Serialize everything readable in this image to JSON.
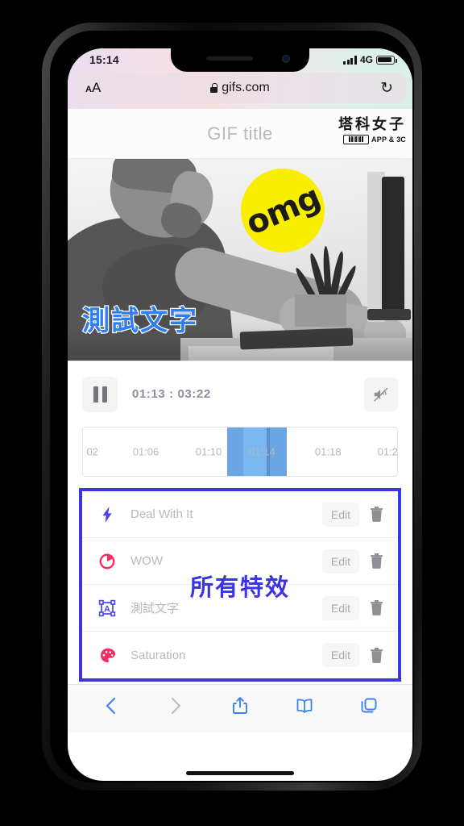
{
  "status_bar": {
    "time": "15:14",
    "network": "4G",
    "signal_icon": "signal-bars-icon",
    "battery_icon": "battery-icon"
  },
  "url_bar": {
    "aa_small": "A",
    "aa_large": "A",
    "lock_icon": "lock-icon",
    "url": "gifs.com",
    "reload_icon": "↻"
  },
  "gif_header": {
    "title": "GIF title",
    "watermark_cn": "塔科女子",
    "watermark_en": "APP & 3C"
  },
  "video": {
    "sticker_text": "omg",
    "sticker_color": "#f9ed00",
    "caption": "測試文字",
    "caption_color": "#2f7ff2"
  },
  "playback": {
    "pause_icon": "pause-icon",
    "current_time": "01:13",
    "separator": ":",
    "total_time": "03:22",
    "time_display": "01:13 : 03:22",
    "mute_icon": "mute-icon"
  },
  "timeline": {
    "ticks": [
      {
        "label": "02",
        "pos": 3
      },
      {
        "label": "01:06",
        "pos": 20
      },
      {
        "label": "01:10",
        "pos": 40
      },
      {
        "label": "01:14",
        "pos": 57
      },
      {
        "label": "01:18",
        "pos": 78
      },
      {
        "label": "01:2",
        "pos": 97
      }
    ],
    "selection_color": "#6ba5e4",
    "selection_start_pct": 46,
    "selection_width_pct": 19
  },
  "effects": {
    "annotation": "所有特效",
    "annotation_color": "#3b35e0",
    "rows": [
      {
        "icon": "lightning-bolt-icon",
        "icon_color": "#4b42e8",
        "label": "Deal With It",
        "edit_label": "Edit",
        "delete_icon": "trash-icon"
      },
      {
        "icon": "pie-circle-icon",
        "icon_color": "#f02e63",
        "label": "WOW",
        "edit_label": "Edit",
        "delete_icon": "trash-icon"
      },
      {
        "icon": "text-box-icon",
        "icon_color": "#4b42e8",
        "label": "測試文字",
        "edit_label": "Edit",
        "delete_icon": "trash-icon"
      },
      {
        "icon": "palette-icon",
        "icon_color": "#f02e63",
        "label": "Saturation",
        "edit_label": "Edit",
        "delete_icon": "trash-icon"
      }
    ]
  },
  "safari_toolbar": {
    "back_icon": "chevron-left-icon",
    "forward_icon": "chevron-right-icon",
    "share_icon": "share-icon",
    "bookmarks_icon": "book-icon",
    "tabs_icon": "tabs-icon",
    "active_color": "#3b82f6",
    "disabled_color": "#bcbcbe"
  }
}
